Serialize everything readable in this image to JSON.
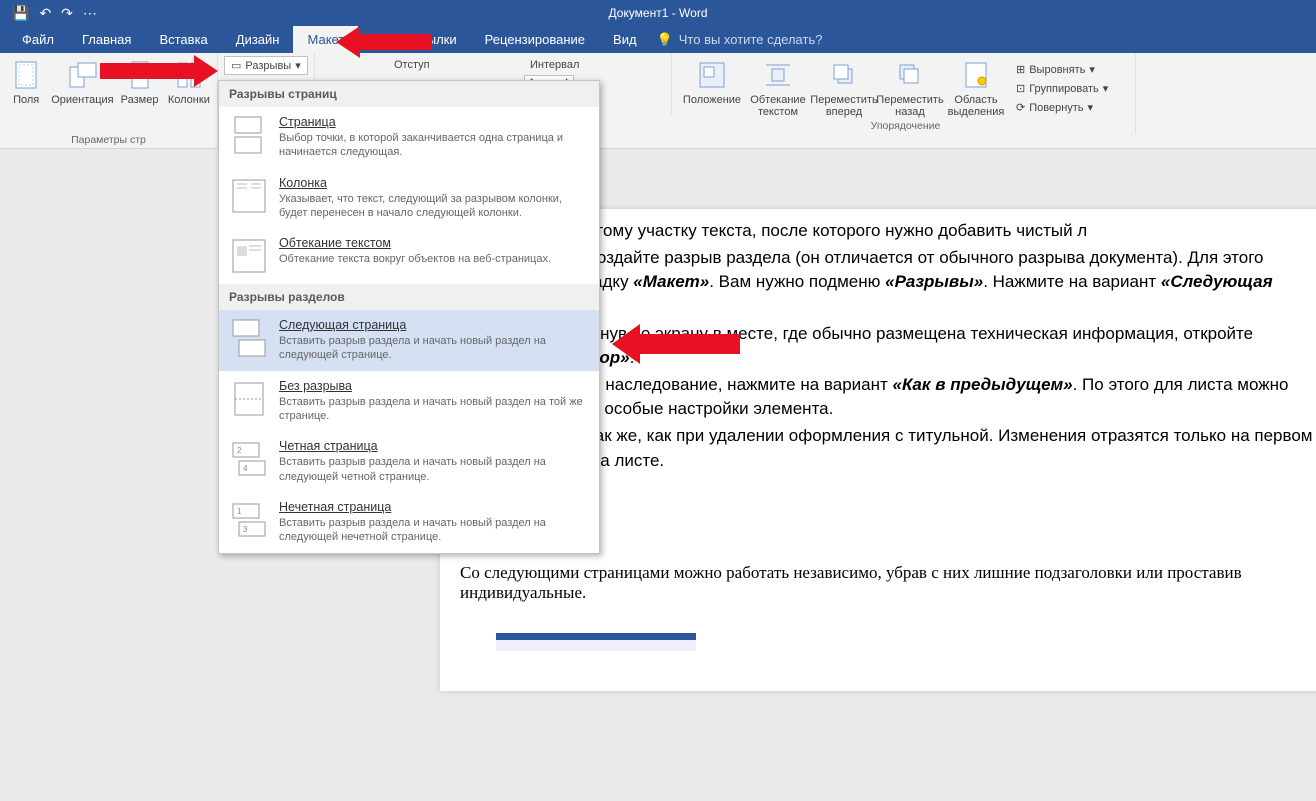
{
  "title": "Документ1 - Word",
  "qat": {
    "save": "💾",
    "undo": "↶",
    "redo": "↷",
    "more": "⋯"
  },
  "tabs": {
    "file": "Файл",
    "home": "Главная",
    "insert": "Вставка",
    "design": "Дизайн",
    "layout": "Макет",
    "mailings": "Рассылки",
    "review": "Рецензирование",
    "view": "Вид"
  },
  "tellme": "Что вы хотите сделать?",
  "lightbulb": "💡",
  "pageSetup": {
    "margins": "Поля",
    "orientation": "Ориентация",
    "size": "Размер",
    "columns": "Колонки",
    "label": "Параметры стр"
  },
  "breaks_btn": "Разрывы",
  "paragraph": {
    "indent_label": "Отступ",
    "spacing_label": "Интервал",
    "auto": "Авто"
  },
  "arrange": {
    "position": "Положение",
    "wrap": "Обтекание текстом",
    "forward": "Переместить вперед",
    "backward": "Переместить назад",
    "selpane": "Область выделения",
    "align": "Выровнять",
    "group": "Группировать",
    "rotate": "Повернуть",
    "label": "Упорядочение"
  },
  "dropdown": {
    "section1": "Разрывы страниц",
    "page": {
      "t": "Страница",
      "d": "Выбор точки, в которой заканчивается одна страница и начинается следующая."
    },
    "column": {
      "t": "Колонка",
      "d": "Указывает, что текст, следующий за разрывом колонки, будет перенесен в начало следующей колонки."
    },
    "textwrap": {
      "t": "Обтекание текстом",
      "d": "Обтекание текста вокруг объектов на веб-страницах."
    },
    "section2": "Разрывы разделов",
    "nextpage": {
      "t": "Следующая страница",
      "d": "Вставить разрыв раздела и начать новый раздел на следующей странице."
    },
    "continuous": {
      "t": "Без разрыва",
      "d": "Вставить разрыв раздела и начать новый раздел на той же странице."
    },
    "evenpage": {
      "t": "Четная страница",
      "d": "Вставить разрыв раздела и начать новый раздел на следующей четной странице."
    },
    "oddpage": {
      "t": "Нечетная страница",
      "d": "Вставить разрыв раздела и начать новый раздел на следующей нечетной странице."
    }
  },
  "doc": {
    "li1a": "Перейдите к тому участку текста, после которого нужно добавить чистый л",
    "li2a": "Для начала создайте разрыв раздела (он отличается от обычного разрыва документа). Для этого откройте вкладку ",
    "li2b": "«Макет»",
    "li2c": ". Вам нужно подменю ",
    "li2d": "«Разрывы»",
    "li2e": ". Нажмите на вариант ",
    "li2f": "«Следующая страница»",
    "li2g": ".",
    "li3a": "Дважды щелкнув по экрану в месте, где обычно размещена техническая информация, откройте ",
    "li3b": "«Конструктор»",
    "li3c": ".",
    "li4a": "Чтобы убрать наследование, нажмите на вариант ",
    "li4b": "«Как в предыдущем»",
    "li4c": ". По этого для листа можно будет указать особые настройки элемента.",
    "li5": "Действуйте так же, как при удалении оформления с титульной. Изменения отразятся только на первом после разрыва листе.",
    "p1": "Со следующими страницами можно работать независимо, убрав с них лишние подзаголовки или проставив индивидуальные."
  }
}
